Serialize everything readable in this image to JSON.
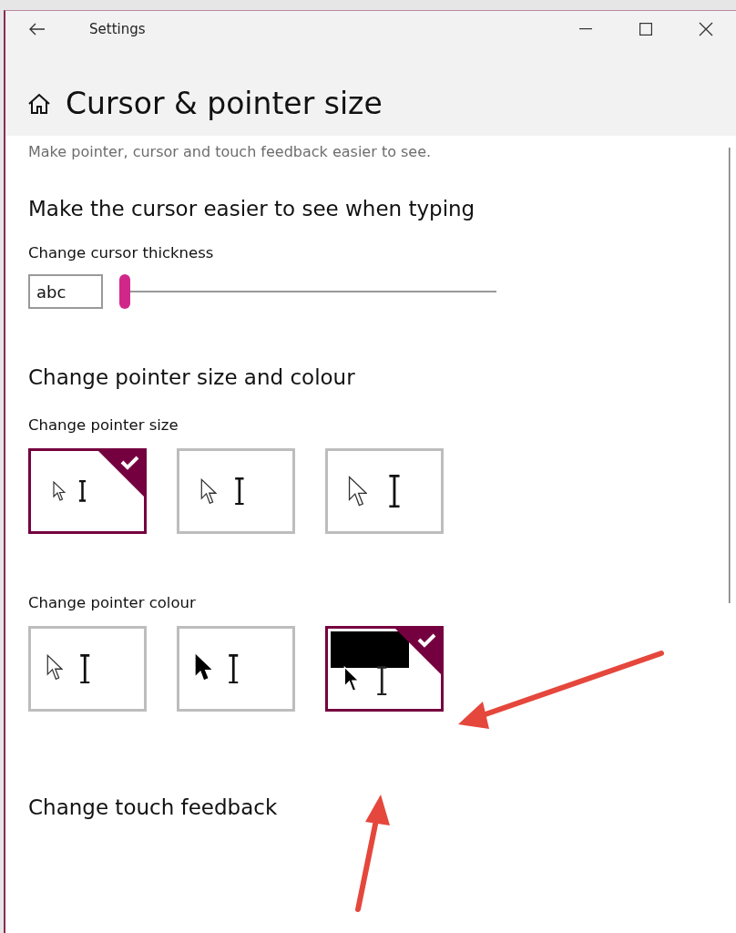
{
  "window": {
    "title": "Settings"
  },
  "page": {
    "title": "Cursor & pointer size",
    "description": "Make pointer, cursor and touch feedback easier to see."
  },
  "cursor_section": {
    "heading": "Make the cursor easier to see when typing",
    "label": "Change cursor thickness",
    "preview": "abc",
    "level": 0.0
  },
  "pointer_section": {
    "heading": "Change pointer size and colour",
    "size_label": "Change pointer size",
    "sizes": [
      {
        "kind": "small",
        "selected": true
      },
      {
        "kind": "medium",
        "selected": false
      },
      {
        "kind": "large",
        "selected": false
      }
    ],
    "colour_label": "Change pointer colour",
    "colours": [
      {
        "kind": "white",
        "selected": false
      },
      {
        "kind": "black",
        "selected": false
      },
      {
        "kind": "inverted",
        "selected": true
      }
    ]
  },
  "touch_section": {
    "heading": "Change touch feedback"
  }
}
